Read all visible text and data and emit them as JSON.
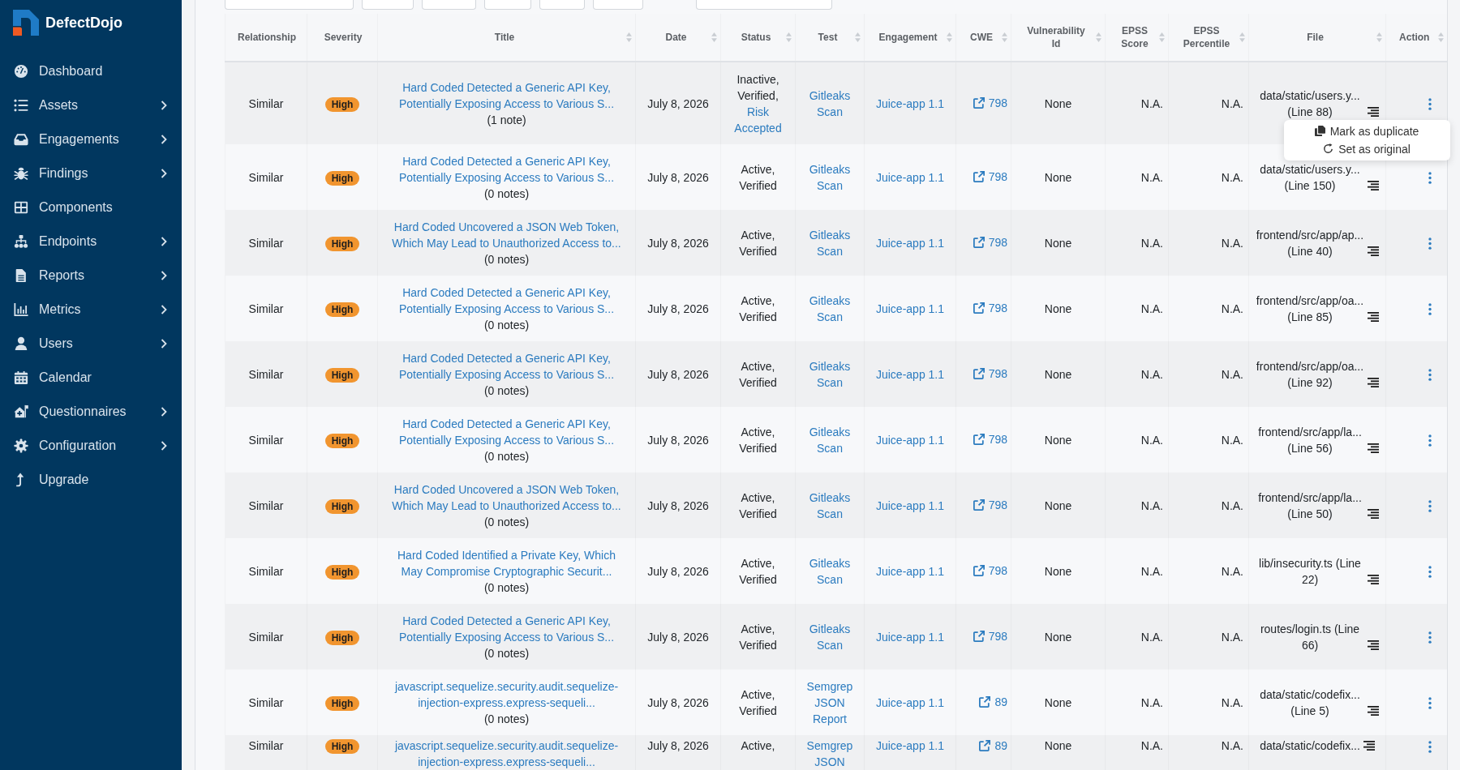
{
  "sidebar": {
    "brand": "DefectDojo",
    "items": [
      {
        "label": "Dashboard",
        "kind": "link"
      },
      {
        "label": "Assets",
        "kind": "submenu"
      },
      {
        "label": "Engagements",
        "kind": "submenu"
      },
      {
        "label": "Findings",
        "kind": "submenu"
      },
      {
        "label": "Components",
        "kind": "link"
      },
      {
        "label": "Endpoints",
        "kind": "submenu"
      },
      {
        "label": "Reports",
        "kind": "submenu"
      },
      {
        "label": "Metrics",
        "kind": "submenu"
      },
      {
        "label": "Users",
        "kind": "submenu"
      },
      {
        "label": "Calendar",
        "kind": "link"
      },
      {
        "label": "Questionnaires",
        "kind": "submenu"
      },
      {
        "label": "Configuration",
        "kind": "submenu"
      },
      {
        "label": "Upgrade",
        "kind": "link"
      }
    ]
  },
  "findings_table": {
    "columns": [
      {
        "label": "Relationship",
        "sortable": false
      },
      {
        "label": "Severity",
        "sortable": false
      },
      {
        "label": "Title",
        "sortable": true
      },
      {
        "label": "Date",
        "sortable": true
      },
      {
        "label": "Status",
        "sortable": true
      },
      {
        "label": "Test",
        "sortable": true
      },
      {
        "label": "Engagement",
        "sortable": true
      },
      {
        "label": "CWE",
        "sortable": true
      },
      {
        "label": "Vulnerability Id",
        "sortable": true
      },
      {
        "label": "EPSS Score",
        "sortable": true
      },
      {
        "label": "EPSS Percentile",
        "sortable": true
      },
      {
        "label": "File",
        "sortable": true
      },
      {
        "label": "Action",
        "sortable": true
      }
    ],
    "rows": [
      {
        "relationship": "Similar",
        "severity": "High",
        "title": "Hard Coded Detected a Generic API Key, Potentially Exposing Access to Various S...",
        "notes": "(1 note)",
        "date": "July 8, 2026",
        "status": "Inactive, Verified,",
        "status_link": "Risk Accepted",
        "test": "Gitleaks Scan",
        "engagement": "Juice-app 1.1",
        "cwe": "798",
        "vulnerability_id": "None",
        "epss_score": "N.A.",
        "epss_percentile": "N.A.",
        "file": "data/static/users.y... (Line 88)",
        "menu_open": true
      },
      {
        "relationship": "Similar",
        "severity": "High",
        "title": "Hard Coded Detected a Generic API Key, Potentially Exposing Access to Various S...",
        "notes": "(0 notes)",
        "date": "July 8, 2026",
        "status": "Active, Verified",
        "test": "Gitleaks Scan",
        "engagement": "Juice-app 1.1",
        "cwe": "798",
        "vulnerability_id": "None",
        "epss_score": "N.A.",
        "epss_percentile": "N.A.",
        "file": "data/static/users.y... (Line 150)",
        "menu_open": false
      },
      {
        "relationship": "Similar",
        "severity": "High",
        "title": "Hard Coded Uncovered a JSON Web Token, Which May Lead to Unauthorized Access to...",
        "notes": "(0 notes)",
        "date": "July 8, 2026",
        "status": "Active, Verified",
        "test": "Gitleaks Scan",
        "engagement": "Juice-app 1.1",
        "cwe": "798",
        "vulnerability_id": "None",
        "epss_score": "N.A.",
        "epss_percentile": "N.A.",
        "file": "frontend/src/app/ap... (Line 40)",
        "menu_open": false
      },
      {
        "relationship": "Similar",
        "severity": "High",
        "title": "Hard Coded Detected a Generic API Key, Potentially Exposing Access to Various S...",
        "notes": "(0 notes)",
        "date": "July 8, 2026",
        "status": "Active, Verified",
        "test": "Gitleaks Scan",
        "engagement": "Juice-app 1.1",
        "cwe": "798",
        "vulnerability_id": "None",
        "epss_score": "N.A.",
        "epss_percentile": "N.A.",
        "file": "frontend/src/app/oa... (Line 85)",
        "menu_open": false
      },
      {
        "relationship": "Similar",
        "severity": "High",
        "title": "Hard Coded Detected a Generic API Key, Potentially Exposing Access to Various S...",
        "notes": "(0 notes)",
        "date": "July 8, 2026",
        "status": "Active, Verified",
        "test": "Gitleaks Scan",
        "engagement": "Juice-app 1.1",
        "cwe": "798",
        "vulnerability_id": "None",
        "epss_score": "N.A.",
        "epss_percentile": "N.A.",
        "file": "frontend/src/app/oa... (Line 92)",
        "menu_open": false
      },
      {
        "relationship": "Similar",
        "severity": "High",
        "title": "Hard Coded Detected a Generic API Key, Potentially Exposing Access to Various S...",
        "notes": "(0 notes)",
        "date": "July 8, 2026",
        "status": "Active, Verified",
        "test": "Gitleaks Scan",
        "engagement": "Juice-app 1.1",
        "cwe": "798",
        "vulnerability_id": "None",
        "epss_score": "N.A.",
        "epss_percentile": "N.A.",
        "file": "frontend/src/app/la... (Line 56)",
        "menu_open": false
      },
      {
        "relationship": "Similar",
        "severity": "High",
        "title": "Hard Coded Uncovered a JSON Web Token, Which May Lead to Unauthorized Access to...",
        "notes": "(0 notes)",
        "date": "July 8, 2026",
        "status": "Active, Verified",
        "test": "Gitleaks Scan",
        "engagement": "Juice-app 1.1",
        "cwe": "798",
        "vulnerability_id": "None",
        "epss_score": "N.A.",
        "epss_percentile": "N.A.",
        "file": "frontend/src/app/la... (Line 50)",
        "menu_open": false
      },
      {
        "relationship": "Similar",
        "severity": "High",
        "title": "Hard Coded Identified a Private Key, Which May Compromise Cryptographic Securit...",
        "notes": "(0 notes)",
        "date": "July 8, 2026",
        "status": "Active, Verified",
        "test": "Gitleaks Scan",
        "engagement": "Juice-app 1.1",
        "cwe": "798",
        "vulnerability_id": "None",
        "epss_score": "N.A.",
        "epss_percentile": "N.A.",
        "file": "lib/insecurity.ts (Line 22)",
        "menu_open": false
      },
      {
        "relationship": "Similar",
        "severity": "High",
        "title": "Hard Coded Detected a Generic API Key, Potentially Exposing Access to Various S...",
        "notes": "(0 notes)",
        "date": "July 8, 2026",
        "status": "Active, Verified",
        "test": "Gitleaks Scan",
        "engagement": "Juice-app 1.1",
        "cwe": "798",
        "vulnerability_id": "None",
        "epss_score": "N.A.",
        "epss_percentile": "N.A.",
        "file": "routes/login.ts (Line 66)",
        "menu_open": false
      },
      {
        "relationship": "Similar",
        "severity": "High",
        "title": "javascript.sequelize.security.audit.sequelize-injection-express.express-sequeli...",
        "notes": "(0 notes)",
        "date": "July 8, 2026",
        "status": "Active, Verified",
        "test": "Semgrep JSON Report",
        "engagement": "Juice-app 1.1",
        "cwe": "89",
        "vulnerability_id": "None",
        "epss_score": "N.A.",
        "epss_percentile": "N.A.",
        "file": "data/static/codefix... (Line 5)",
        "menu_open": false
      },
      {
        "relationship": "Similar",
        "severity": "High",
        "title": "javascript.sequelize.security.audit.sequelize-injection-express.express-sequeli...",
        "date": "July 8, 2026",
        "status": "Active,",
        "test": "Semgrep JSON",
        "engagement": "Juice-app 1.1",
        "cwe": "89",
        "vulnerability_id": "None",
        "epss_score": "N.A.",
        "epss_percentile": "N.A.",
        "file": "data/static/codefix...",
        "menu_open": false
      }
    ]
  },
  "action_menu": {
    "items": [
      {
        "label": "Mark as duplicate",
        "kind": "duplicate"
      },
      {
        "label": "Set as original",
        "kind": "original"
      }
    ]
  }
}
